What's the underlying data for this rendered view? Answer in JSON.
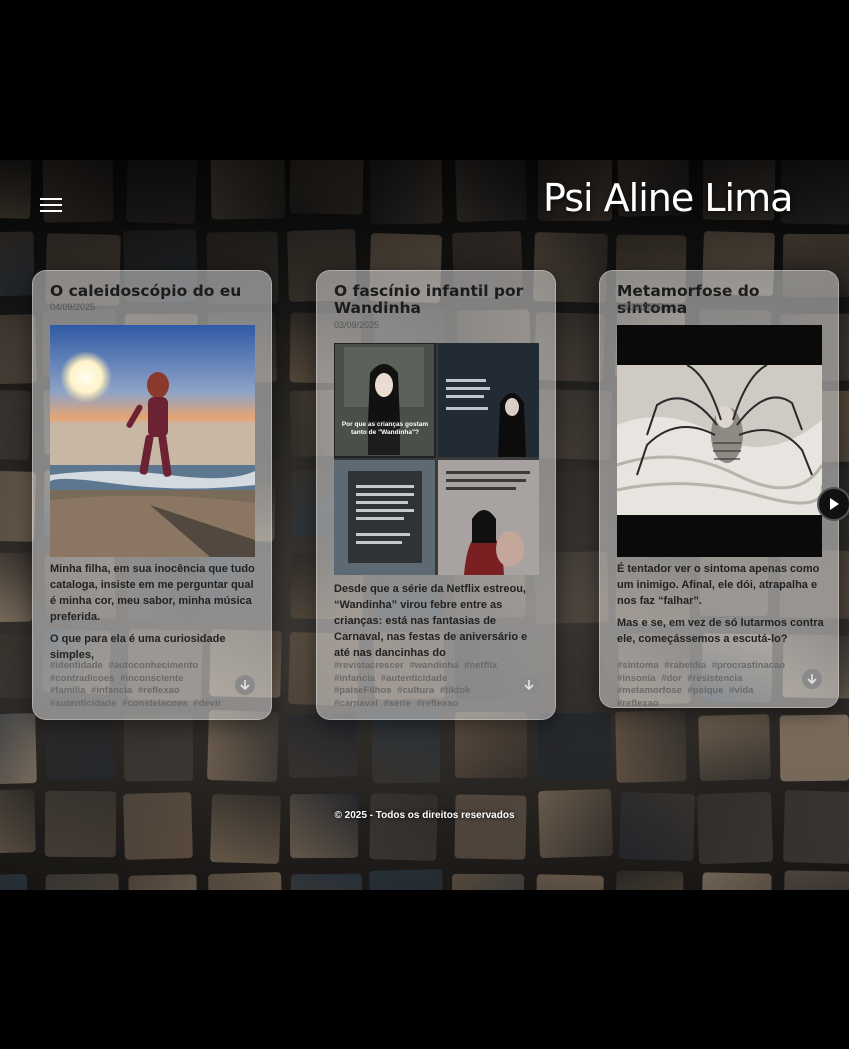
{
  "header": {
    "logo": "Psi Aline Lima",
    "menu_icon": "hamburger-menu-icon"
  },
  "cards": [
    {
      "title": "O caleidoscópio do eu",
      "date": "04/09/2025",
      "image": "girl-jumping-on-beach-at-sunset",
      "paragraphs": [
        "Minha filha, em sua inocência que tudo cataloga, insiste em me perguntar qual é minha cor, meu sabor, minha música preferida.",
        "O que para ela é uma curiosidade simples,"
      ],
      "tags": [
        "#identidade",
        "#autoconhecimento",
        "#contradicoes",
        "#inconsciente",
        "#familia",
        "#infancia",
        "#reflexao",
        "#autenticidade",
        "#constelacoes",
        "#devir"
      ]
    },
    {
      "title": "O fascínio infantil por Wandinha",
      "date": "03/09/2025",
      "image": "wandinha-collage",
      "collage_caption": "Por que as crianças gostam tanto de \"Wandinha\"?",
      "paragraphs": [
        "Desde que a série da Netflix estreou, “Wandinha” virou febre entre as crianças: está nas fantasias de Carnaval, nas festas de aniversário e até nas dancinhas do"
      ],
      "tags": [
        "#revistacrescer",
        "#wandinha",
        "#netflix",
        "#infancia",
        "#autenticidade",
        "#paiseFilhos",
        "#cultura",
        "#tiktok",
        "#carnaval",
        "#serie",
        "#reflexao"
      ]
    },
    {
      "title": "Metamorfose do sintoma",
      "date": "03/09/2025",
      "image": "bed-with-spider-creature",
      "paragraphs": [
        "É tentador ver o sintoma apenas como um inimigo. Afinal, ele dói, atrapalha e nos faz “falhar”.",
        "Mas e se, em vez de só lutarmos contra ele, começássemos a escutá-lo?"
      ],
      "tags": [
        "#sintoma",
        "#rabeldia",
        "#procrastinacao",
        "#insonia",
        "#dor",
        "#resistencia",
        "#metamorfose",
        "#psique",
        "#vida",
        "#reflexao"
      ]
    }
  ],
  "carousel": {
    "next_icon": "next-arrow-icon"
  },
  "footer": {
    "copyright": "© 2025 - Todos os direitos reservados"
  },
  "colors": {
    "background": "#000000",
    "card": "#d7d7d7",
    "logo": "#ffffff"
  }
}
